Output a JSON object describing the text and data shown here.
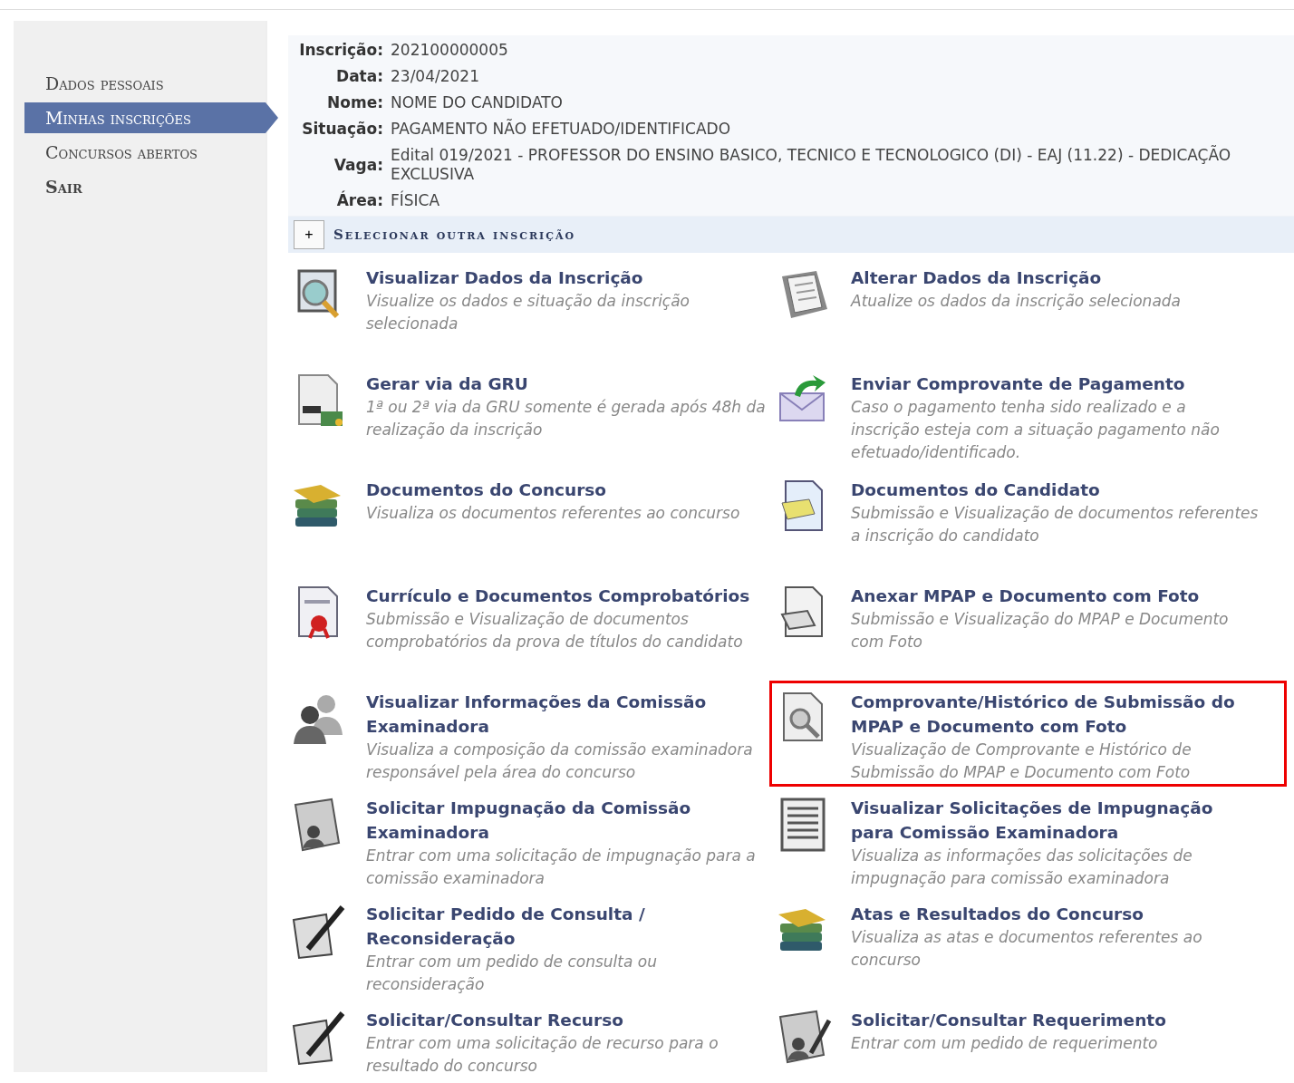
{
  "sidebar": {
    "items": [
      {
        "label": "Dados pessoais",
        "selected": false
      },
      {
        "label": "Minhas inscrições",
        "selected": true
      },
      {
        "label": "Concursos abertos",
        "selected": false
      },
      {
        "label": "Sair",
        "selected": false
      }
    ]
  },
  "inscription": {
    "fields": [
      {
        "label": "Inscrição:",
        "value": "202100000005"
      },
      {
        "label": "Data:",
        "value": "23/04/2021"
      },
      {
        "label": "Nome:",
        "value": "NOME DO CANDIDATO"
      },
      {
        "label": "Situação:",
        "value": "PAGAMENTO NÃO EFETUADO/IDENTIFICADO"
      },
      {
        "label": "Vaga:",
        "value": "Edital 019/2021 - PROFESSOR DO ENSINO BASICO, TECNICO E TECNOLOGICO (DI) - EAJ (11.22) - DEDICAÇÃO EXCLUSIVA"
      },
      {
        "label": "Área:",
        "value": "FÍSICA"
      }
    ],
    "toggle": {
      "symbol": "+",
      "label": "Selecionar outra inscrição"
    }
  },
  "actions": [
    {
      "kind": "search-doc",
      "title": "Visualizar Dados da Inscrição",
      "description": "Visualize os dados e situação da inscrição selecionada",
      "highlighted": false
    },
    {
      "kind": "edit-doc",
      "title": "Alterar Dados da Inscrição",
      "description": "Atualize os dados da inscrição selecionada",
      "highlighted": false
    },
    {
      "kind": "invoice",
      "title": "Gerar via da GRU",
      "description": "1ª ou 2ª via da GRU somente é gerada após 48h da realização da inscrição",
      "highlighted": false
    },
    {
      "kind": "envelope",
      "title": "Enviar Comprovante de Pagamento",
      "description": "Caso o pagamento tenha sido realizado e a inscrição esteja com a situação pagamento não efetuado/identificado.",
      "highlighted": false
    },
    {
      "kind": "books",
      "title": "Documentos do Concurso",
      "description": "Visualiza os documentos referentes ao concurso",
      "highlighted": false
    },
    {
      "kind": "note-doc",
      "title": "Documentos do Candidato",
      "description": "Submissão e Visualização de documentos referentes a inscrição do candidato",
      "highlighted": false
    },
    {
      "kind": "certificate",
      "title": "Currículo e Documentos Comprobatórios",
      "description": "Submissão e Visualização de documentos comprobatórios da prova de títulos do candidato",
      "highlighted": false
    },
    {
      "kind": "clip-doc",
      "title": "Anexar MPAP e Documento com Foto",
      "description": "Submissão e Visualização do MPAP e Documento com Foto",
      "highlighted": false
    },
    {
      "kind": "people",
      "title": "Visualizar Informações da Comissão Examinadora",
      "description": "Visualiza a composição da comissão examinadora responsável pela área do concurso",
      "highlighted": false
    },
    {
      "kind": "magnifier-doc",
      "title": "Comprovante/Histórico de Submissão do MPAP e Documento com Foto",
      "description": "Visualização de Comprovante e Histórico de Submissão do MPAP e Documento com Foto",
      "highlighted": true
    },
    {
      "kind": "id-card",
      "title": "Solicitar Impugnação da Comissão Examinadora",
      "description": "Entrar com uma solicitação de impugnação para a comissão examinadora",
      "highlighted": false
    },
    {
      "kind": "list-doc",
      "title": "Visualizar Solicitações de Impugnação para Comissão Examinadora",
      "description": "Visualiza as informações das solicitações de impugnação para comissão examinadora",
      "highlighted": false
    },
    {
      "kind": "pen-doc",
      "title": "Solicitar Pedido de Consulta / Reconsideração",
      "description": "Entrar com um pedido de consulta ou reconsideração",
      "highlighted": false
    },
    {
      "kind": "books",
      "title": "Atas e Resultados do Concurso",
      "description": "Visualiza as atas e documentos referentes ao concurso",
      "highlighted": false
    },
    {
      "kind": "pen-doc",
      "title": "Solicitar/Consultar Recurso",
      "description": "Entrar com uma solicitação de recurso para o resultado do concurso",
      "highlighted": false
    },
    {
      "kind": "id-card-pen",
      "title": "Solicitar/Consultar Requerimento",
      "description": "Entrar com um pedido de requerimento",
      "highlighted": false
    }
  ]
}
